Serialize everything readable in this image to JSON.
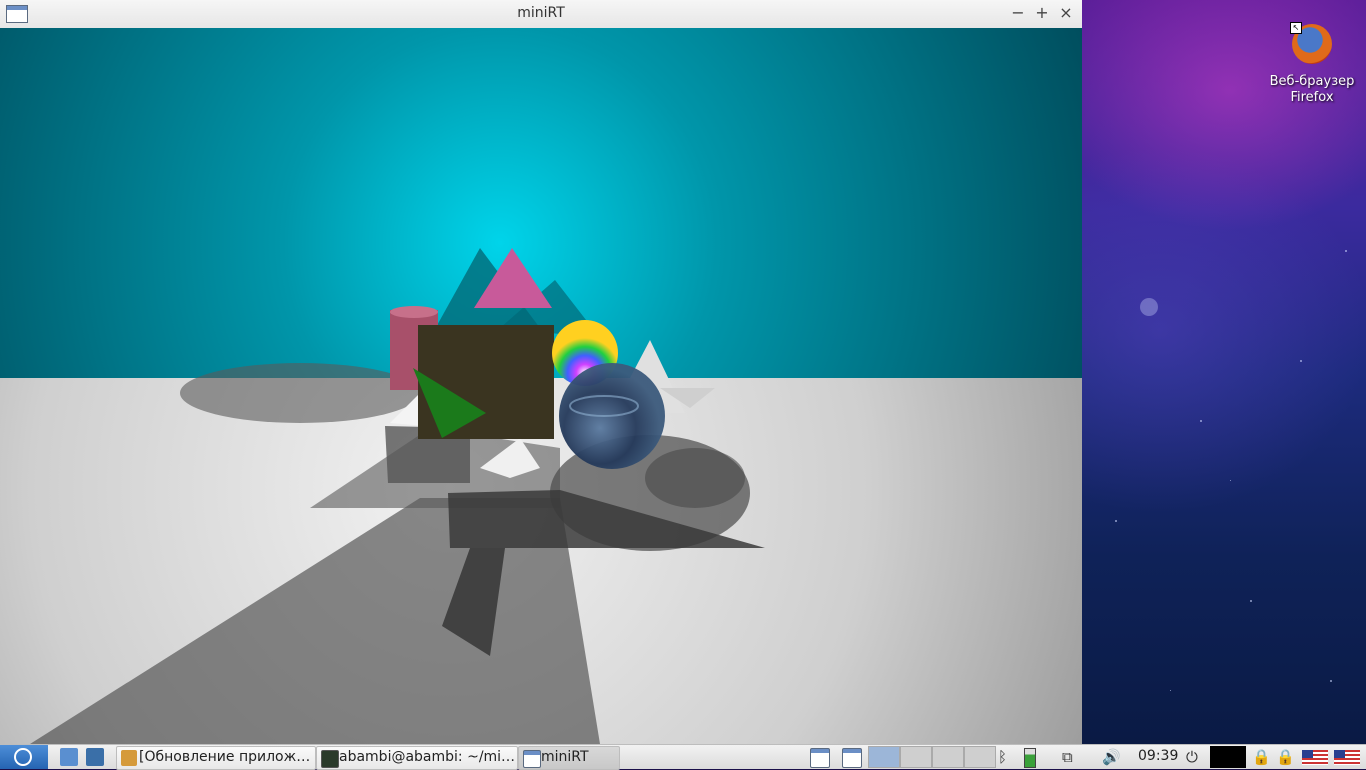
{
  "window": {
    "title": "miniRT",
    "controls": {
      "minimize": "−",
      "maximize": "+",
      "close": "×"
    }
  },
  "desktop": {
    "icons": [
      {
        "label_line1": "Веб-браузер",
        "label_line2": "Firefox",
        "icon": "firefox-icon"
      }
    ]
  },
  "taskbar": {
    "tasks": [
      {
        "label": "[Обновление прилож…",
        "icon": "package-update-icon"
      },
      {
        "label": "abambi@abambi: ~/mi…",
        "icon": "terminal-icon"
      },
      {
        "label": "miniRT",
        "icon": "window-icon"
      }
    ],
    "clock": "09:39",
    "colors": {
      "accent": "#2564b2"
    }
  }
}
